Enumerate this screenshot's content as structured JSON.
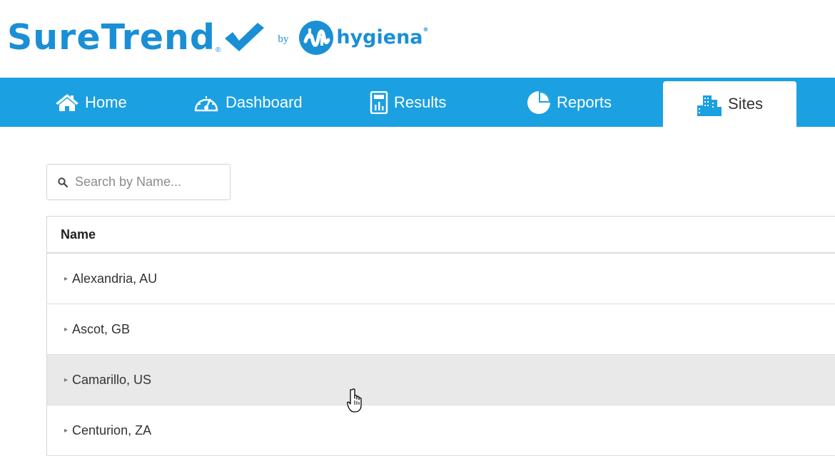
{
  "brand": {
    "name": "SureTrend",
    "by": "by",
    "company": "hygiena",
    "reg": "®",
    "color": "#1a8fd6"
  },
  "nav": {
    "color": "#1ba0e2",
    "items": [
      {
        "label": "Home",
        "icon": "home-icon"
      },
      {
        "label": "Dashboard",
        "icon": "gauge-icon"
      },
      {
        "label": "Results",
        "icon": "calculator-icon"
      },
      {
        "label": "Reports",
        "icon": "pie-chart-icon"
      },
      {
        "label": "Sites",
        "icon": "buildings-icon",
        "active": true
      }
    ]
  },
  "search": {
    "placeholder": "Search by Name..."
  },
  "table": {
    "header": "Name",
    "rows": [
      {
        "name": "Alexandria, AU"
      },
      {
        "name": "Ascot, GB"
      },
      {
        "name": "Camarillo, US",
        "hovered": true
      },
      {
        "name": "Centurion, ZA"
      }
    ],
    "caret": "▸"
  }
}
